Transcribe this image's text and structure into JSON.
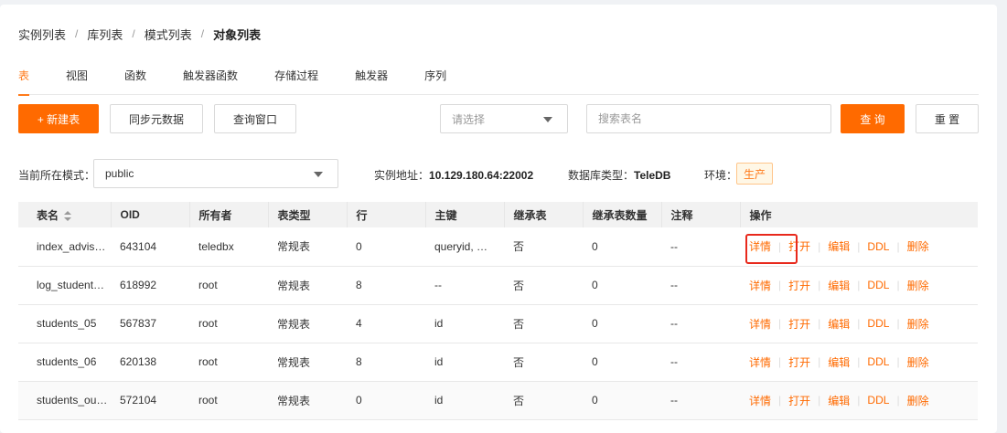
{
  "breadcrumb": [
    {
      "label": "实例列表"
    },
    {
      "label": "库列表"
    },
    {
      "label": "模式列表"
    },
    {
      "label": "对象列表"
    }
  ],
  "breadcrumb_sep": "/",
  "tabs": [
    {
      "label": "表",
      "active": true
    },
    {
      "label": "视图"
    },
    {
      "label": "函数"
    },
    {
      "label": "触发器函数"
    },
    {
      "label": "存储过程"
    },
    {
      "label": "触发器"
    },
    {
      "label": "序列"
    }
  ],
  "toolbar": {
    "new_table": "+ 新建表",
    "sync_meta": "同步元数据",
    "query_window": "查询窗口",
    "select_placeholder": "请选择",
    "search_placeholder": "搜索表名",
    "query_button": "查 询",
    "reset_button": "重 置"
  },
  "info": {
    "schema_label": "当前所在模式：",
    "schema_value": "public",
    "instance_label": "实例地址：",
    "instance_value": "10.129.180.64:22002",
    "dbtype_label": "数据库类型：",
    "dbtype_value": "TeleDB",
    "env_label": "环境：",
    "env_value": "生产"
  },
  "table": {
    "headers": [
      "表名",
      "OID",
      "所有者",
      "表类型",
      "行",
      "主键",
      "继承表",
      "继承表数量",
      "注释",
      "操作"
    ],
    "rows": [
      {
        "name": "index_advis…",
        "oid": "643104",
        "owner": "teledbx",
        "type": "常规表",
        "rows": "0",
        "pk": "queryid, …",
        "inherit": "否",
        "inherit_count": "0",
        "comment": "--"
      },
      {
        "name": "log_student…",
        "oid": "618992",
        "owner": "root",
        "type": "常规表",
        "rows": "8",
        "pk": "--",
        "inherit": "否",
        "inherit_count": "0",
        "comment": "--"
      },
      {
        "name": "students_05",
        "oid": "567837",
        "owner": "root",
        "type": "常规表",
        "rows": "4",
        "pk": "id",
        "inherit": "否",
        "inherit_count": "0",
        "comment": "--"
      },
      {
        "name": "students_06",
        "oid": "620138",
        "owner": "root",
        "type": "常规表",
        "rows": "8",
        "pk": "id",
        "inherit": "否",
        "inherit_count": "0",
        "comment": "--"
      },
      {
        "name": "students_ou…",
        "oid": "572104",
        "owner": "root",
        "type": "常规表",
        "rows": "0",
        "pk": "id",
        "inherit": "否",
        "inherit_count": "0",
        "comment": "--"
      }
    ],
    "actions": [
      "详情",
      "打开",
      "编辑",
      "DDL",
      "删除"
    ],
    "action_sep": "|"
  },
  "colors": {
    "accent": "#ff6a00",
    "highlight": "#e8291c"
  }
}
